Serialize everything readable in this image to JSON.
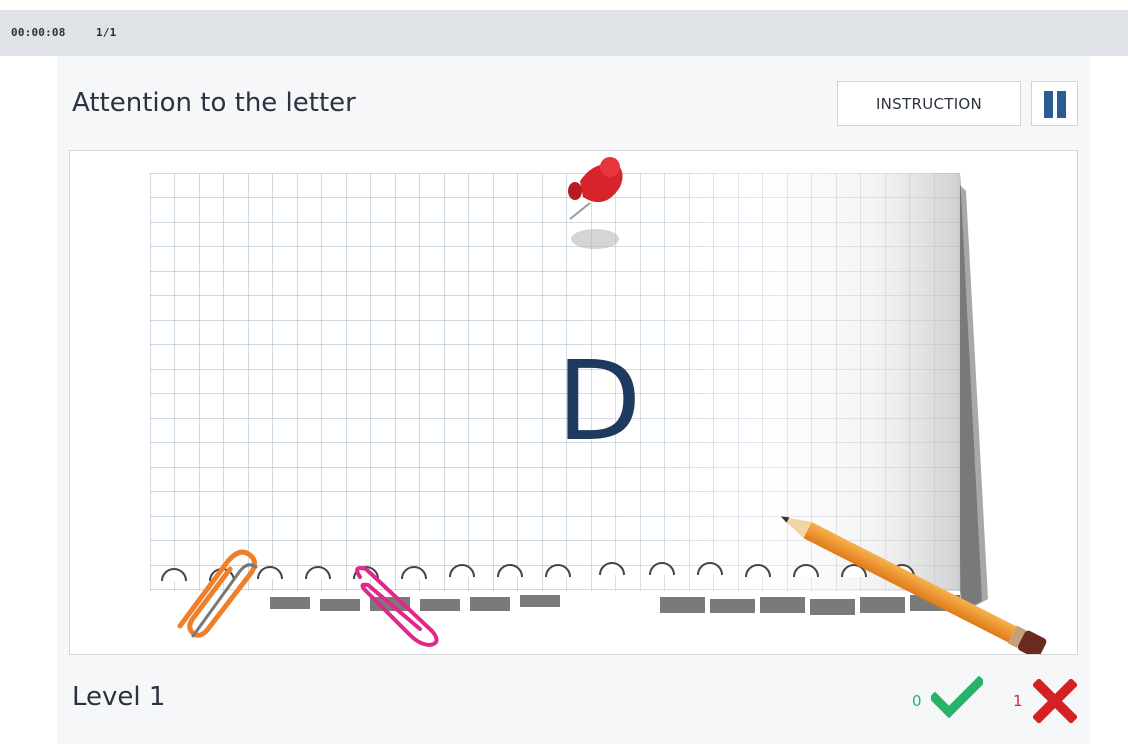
{
  "status": {
    "timer": "00:00:08",
    "progress": "1/1"
  },
  "game": {
    "title": "Attention to the letter",
    "letter": "D",
    "level": "Level 1"
  },
  "toolbar": {
    "instruction_label": "INSTRUCTION",
    "pause_icon": "pause-icon"
  },
  "score": {
    "correct": "0",
    "wrong": "1",
    "correct_color": "#2ab26b",
    "wrong_color": "#e0262b"
  },
  "colors": {
    "accent": "#2a5c93",
    "letter": "#1f3a5f",
    "pin": "#d8232a",
    "clip_orange": "#ef7f2a",
    "clip_pink": "#e0288a",
    "pencil": "#f29a2e"
  }
}
